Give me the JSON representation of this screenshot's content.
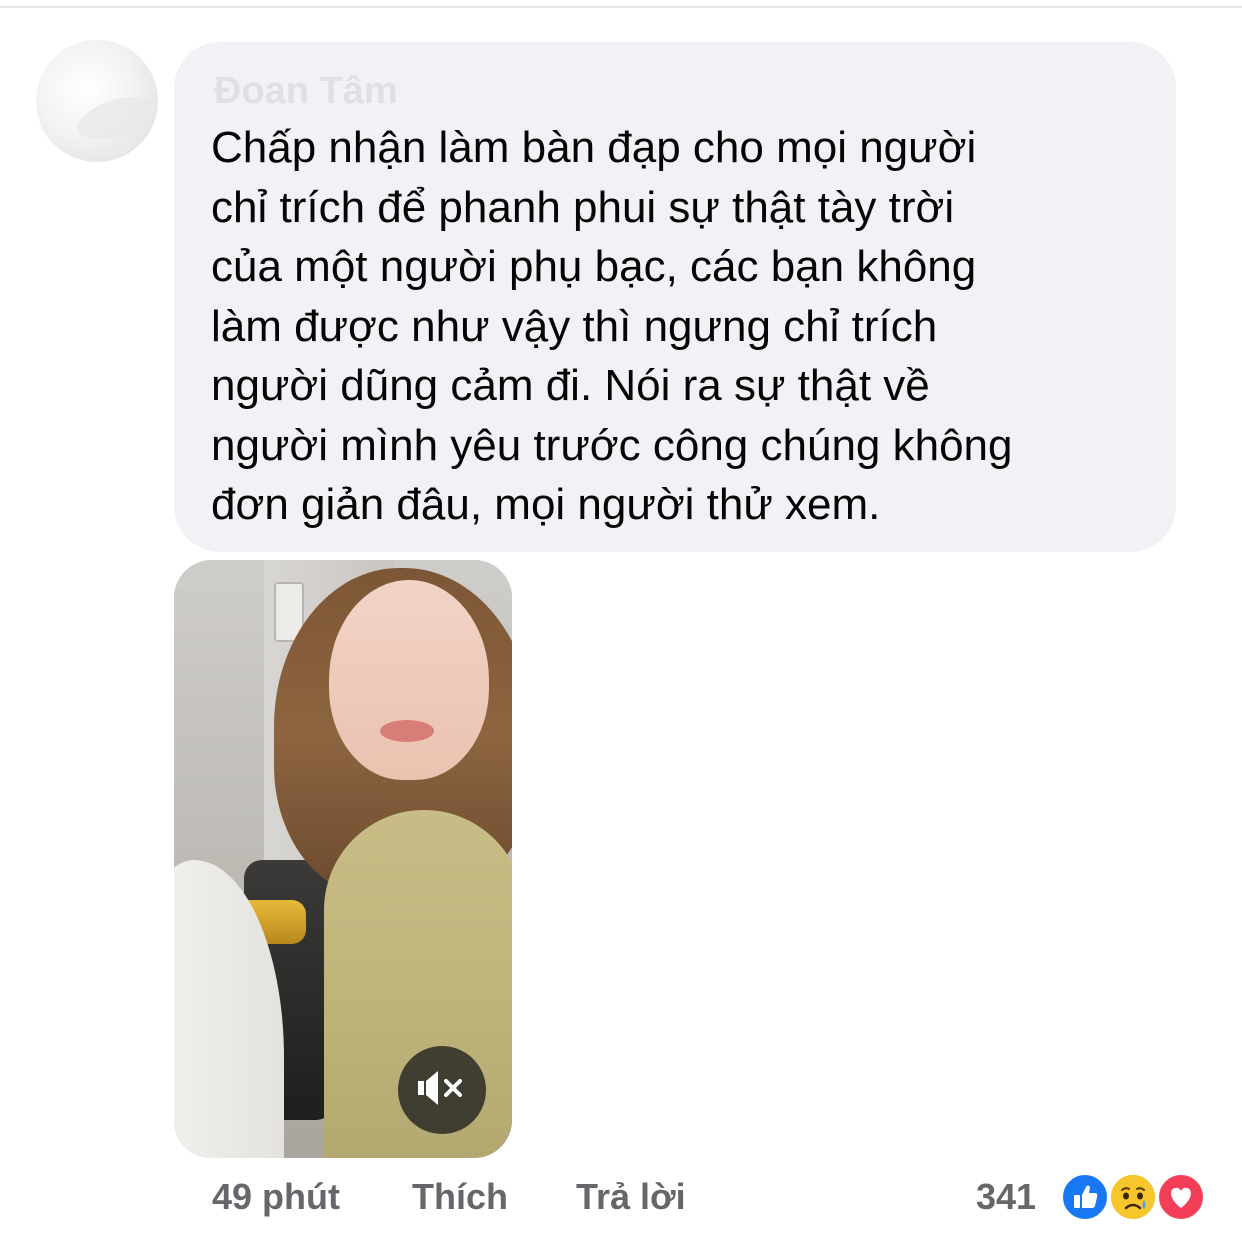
{
  "comment": {
    "author": "Đoan Tâm",
    "lines": [
      "Chấp nhận làm bàn đạp cho mọi người",
      "chỉ trích để phanh phui sự thật tày trời",
      "của một người phụ bạc, các bạn không",
      "làm được như vậy thì ngưng chỉ trích",
      "người dũng cảm đi. Nói ra sự thật về",
      "người mình yêu trước công chúng không",
      "đơn giản đâu, mọi người thử xem."
    ]
  },
  "video": {
    "muted": true,
    "mute_icon": "speaker-muted-icon"
  },
  "actions": {
    "time": "49 phút",
    "like_label": "Thích",
    "reply_label": "Trả lời"
  },
  "reactions": {
    "count": "341",
    "types": [
      "like-reaction-icon",
      "sad-reaction-icon",
      "love-reaction-icon"
    ],
    "colors": {
      "like": "#1877f2",
      "sad": "#f7b125",
      "love": "#f33e58"
    }
  }
}
